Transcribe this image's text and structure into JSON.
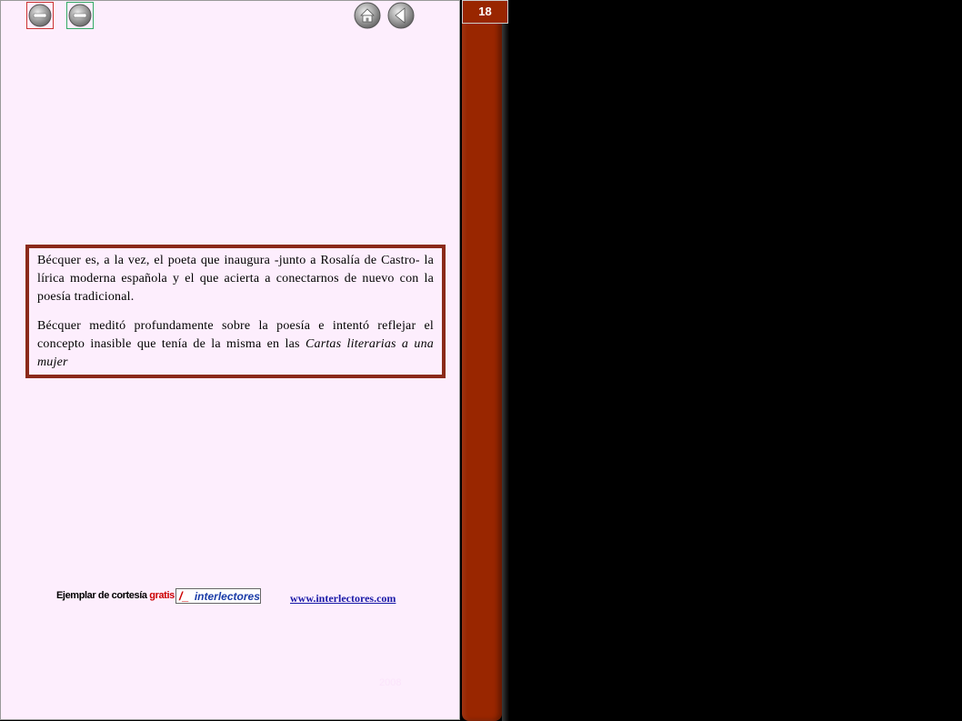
{
  "page_number": "18",
  "nav": {
    "buttons": [
      {
        "icon": "minus-circle-icon",
        "frame_color": "#cc3333"
      },
      {
        "icon": "minus-circle-icon",
        "frame_color": "#33aa66"
      },
      {
        "icon": "home-icon"
      },
      {
        "icon": "back-arrow-icon"
      }
    ]
  },
  "content": {
    "paragraph1": "Bécquer es, a la vez, el poeta que inaugura -junto a Rosalía de Castro- la lírica moderna española y el que acierta a conectarnos de nuevo con la poesía tradicional.",
    "paragraph2_text": "Bécquer meditó profundamente sobre la poesía e intentó reflejar el concepto inasible que tenía de la misma en las ",
    "paragraph2_italic": "Cartas literarias a una mujer"
  },
  "footer": {
    "label_prefix": "Ejemplar de cortesía ",
    "label_gratis": "gratis",
    "logo_slash": "/_",
    "logo_text": "interlectores",
    "link": "www.interlectores.com",
    "year": "2008"
  },
  "colors": {
    "page_bg": "#fdeefd",
    "sidebar": "#992600",
    "border": "#8b2a1a",
    "link": "#1a1aa8"
  }
}
